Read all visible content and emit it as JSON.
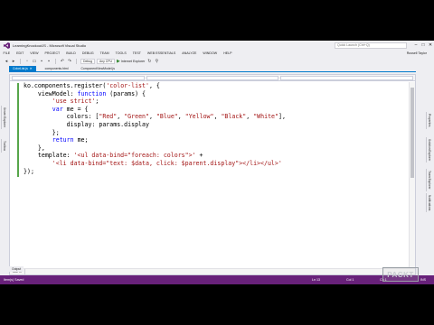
{
  "window": {
    "title": "LearningKnockoutJS - Microsoft Visual Studio",
    "quick_launch_placeholder": "Quick Launch (Ctrl+Q)",
    "user": "Russell Taylor"
  },
  "menu": [
    "FILE",
    "EDIT",
    "VIEW",
    "PROJECT",
    "BUILD",
    "DEBUG",
    "TEAM",
    "TOOLS",
    "TEST",
    "WEB ESSENTIALS",
    "ANALYZE",
    "WINDOW",
    "HELP"
  ],
  "toolbar": {
    "config": "Debug",
    "platform": "Any CPU",
    "run_label": "Internet Explorer"
  },
  "tabs": [
    {
      "label": "ColorList.js",
      "active": true
    },
    {
      "label": "components.html",
      "active": false
    },
    {
      "label": "ComponentViewModel.js",
      "active": false
    }
  ],
  "left_panels": [
    "Server Explorer",
    "Toolbox"
  ],
  "right_panels": [
    "Properties",
    "Solution Explorer",
    "Team Explorer",
    "Notifications"
  ],
  "code": [
    [
      {
        "t": "ko.components.register("
      },
      {
        "t": "'color-list'",
        "c": "str"
      },
      {
        "t": ", {"
      }
    ],
    [
      {
        "t": "    viewModel: "
      },
      {
        "t": "function",
        "c": "kw"
      },
      {
        "t": " (params) {"
      }
    ],
    [
      {
        "t": "        "
      },
      {
        "t": "'use strict'",
        "c": "str"
      },
      {
        "t": ";"
      }
    ],
    [
      {
        "t": "        "
      },
      {
        "t": "var",
        "c": "kw"
      },
      {
        "t": " me = {"
      }
    ],
    [
      {
        "t": "            colors: ["
      },
      {
        "t": "\"Red\"",
        "c": "str"
      },
      {
        "t": ", "
      },
      {
        "t": "\"Green\"",
        "c": "str"
      },
      {
        "t": ", "
      },
      {
        "t": "\"Blue\"",
        "c": "str"
      },
      {
        "t": ", "
      },
      {
        "t": "\"Yellow\"",
        "c": "str"
      },
      {
        "t": ", "
      },
      {
        "t": "\"Black\"",
        "c": "str"
      },
      {
        "t": ", "
      },
      {
        "t": "\"White\"",
        "c": "str"
      },
      {
        "t": "],"
      }
    ],
    [
      {
        "t": "            display: params.display"
      }
    ],
    [
      {
        "t": "        };"
      }
    ],
    [
      {
        "t": "        "
      },
      {
        "t": "return",
        "c": "kw"
      },
      {
        "t": " me;"
      }
    ],
    [
      {
        "t": "    },"
      }
    ],
    [
      {
        "t": "    template: "
      },
      {
        "t": "'<ul data-bind=\"foreach: colors\">'",
        "c": "str"
      },
      {
        "t": " +"
      }
    ],
    [
      {
        "t": "        "
      },
      {
        "t": "'<li data-bind=\"text: $data, click: $parent.display\"></li></ul>'",
        "c": "str"
      }
    ],
    [
      {
        "t": "});"
      }
    ]
  ],
  "editor": {
    "zoom": "100 %"
  },
  "output_tab": "Output",
  "status": {
    "message": "Item(s) Saved",
    "line": "Ln 13",
    "col": "Col 1",
    "ch": "Ch 1",
    "mode": "INS"
  },
  "watermark": "PACKT"
}
